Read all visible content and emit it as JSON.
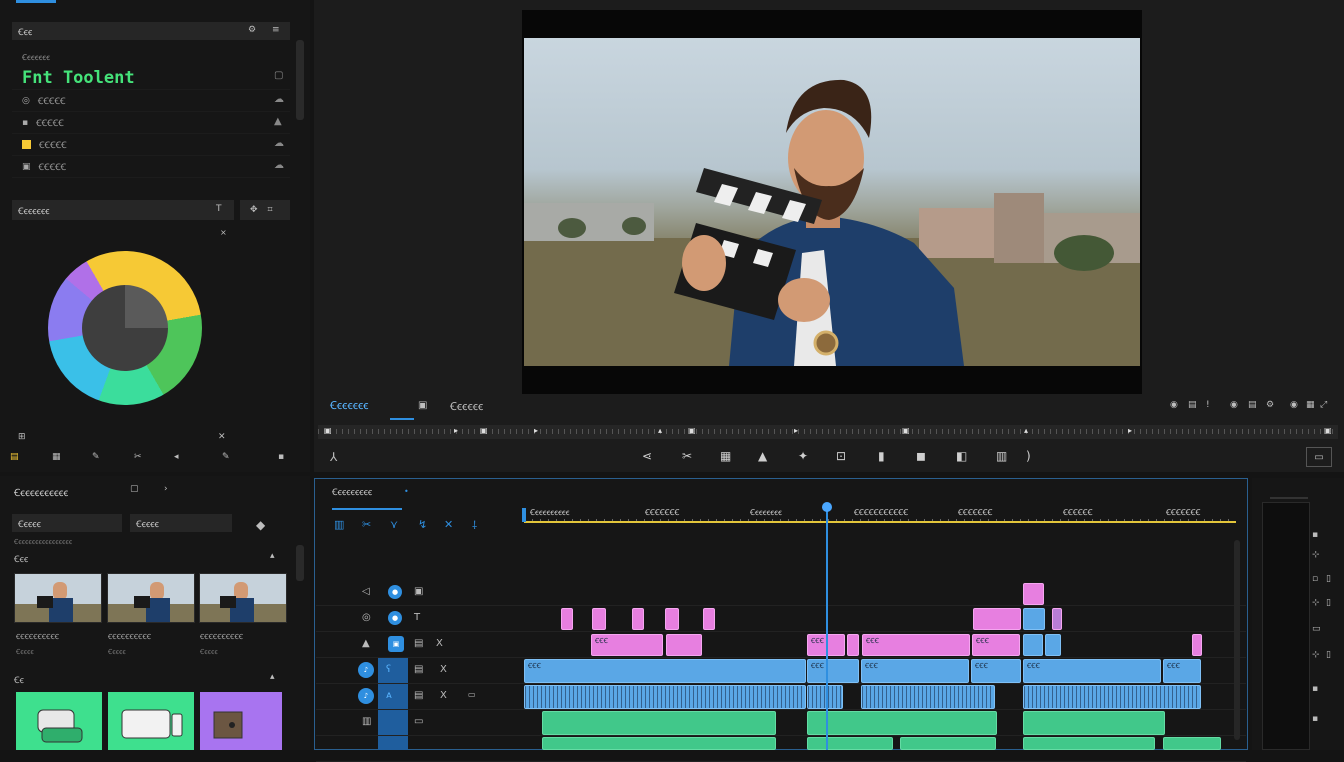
{
  "left_top": {
    "header": "Ꞓꞓꞓ",
    "subtitle": "Ꞓꞓꞓꞓꞓꞓꞓ",
    "heading": "Fnt Toolent",
    "items": [
      {
        "label": "ꞒꞒꞒꞒꞒ"
      },
      {
        "label": "ꞒꞒꞒꞒꞒ"
      },
      {
        "label": "ꞒꞒꞒꞒꞒ"
      },
      {
        "label": "ꞒꞒꞒꞒꞒ"
      }
    ]
  },
  "color_panel": {
    "title": "Ꞓꞓꞓꞓꞓꞓꞓ",
    "wheel_colors": [
      "#f6c935",
      "#4ec55a",
      "#3bdd9c",
      "#3ac0e8",
      "#8b7cf0",
      "#b070e8"
    ]
  },
  "media_panel": {
    "title": "Ꞓꞓꞓꞓꞓꞓꞓꞓꞓꞓꞓ",
    "dropdown1": "Ꞓꞓꞓꞓꞓ",
    "dropdown2": "Ꞓꞓꞓꞓꞓ",
    "path": "Ꞓꞓꞓꞓꞓꞓꞓꞓꞓꞓꞓꞓꞓꞓꞓꞓꞓ",
    "section1": "Ꞓꞓꞓ",
    "thumbs": [
      {
        "label": "ꞒꞒꞒꞒꞒꞒꞒꞒꞒꞒ",
        "sub": "Ꞓꞓꞓꞓꞓ"
      },
      {
        "label": "ꞒꞒꞒꞒꞒꞒꞒꞒꞒꞒ",
        "sub": "Ꞓꞓꞓꞓꞓ"
      },
      {
        "label": "ꞒꞒꞒꞒꞒꞒꞒꞒꞒꞒ",
        "sub": "Ꞓꞓꞓꞓꞓ"
      }
    ],
    "section2": "Ꞓꞓ",
    "tile_colors": [
      "#3ee08e",
      "#3ee08e",
      "#a874f0"
    ]
  },
  "preview": {
    "tabs": [
      {
        "label": "Ꞓꞓꞓꞓꞓꞓꞓ"
      },
      {
        "label": "Ꞓꞓꞓꞓꞓꞓ"
      }
    ]
  },
  "timeline": {
    "title": "Ꞓꞓꞓꞓꞓꞓꞓꞓꞓ",
    "ruler": [
      "Ꞓꞓꞓꞓꞓꞓꞓꞓꞓꞓ",
      "ꞒꞒꞒꞒꞒꞒꞒ",
      "Ꞓꞓꞓꞓꞓꞓꞓꞓ",
      "ꞒꞒꞒꞒꞒꞒꞒꞒꞒꞒꞒ",
      "ꞒꞒꞒꞒꞒꞒꞒ",
      "ꞒꞒꞒꞒꞒꞒ",
      "ꞒꞒꞒꞒꞒꞒꞒ"
    ],
    "clip_label": "ꞒꞒꞒ",
    "colors": {
      "video": "#e77fe0",
      "audio": "#5aa7e6",
      "music": "#41c88a",
      "accent": "#2f8fe0"
    }
  }
}
